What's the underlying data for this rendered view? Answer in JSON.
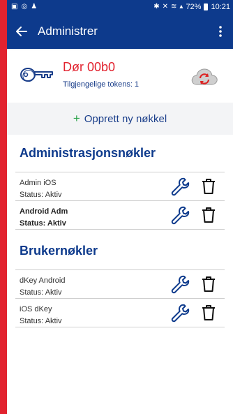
{
  "statusbar": {
    "left_icons": [
      "gallery-icon",
      "whatsapp-icon",
      "person-icon"
    ],
    "right_icons": [
      "bluetooth-icon",
      "mute-icon",
      "wifi-icon",
      "signal-icon"
    ],
    "battery": "72%",
    "time": "10:21"
  },
  "appbar": {
    "title": "Administrer",
    "back_icon": "arrow-left-icon",
    "menu_icon": "more-vertical-icon"
  },
  "door": {
    "name": "Dør 00b0",
    "tokens_label": "Tilgjengelige tokens: 1"
  },
  "create": {
    "plus": "+",
    "label": "Opprett ny nøkkel"
  },
  "admin_section": {
    "title": "Administrasjonsnøkler",
    "keys": [
      {
        "name": "Admin iOS",
        "status": "Status: Aktiv"
      },
      {
        "name": "Android Adm",
        "status": "Status: Aktiv"
      }
    ]
  },
  "user_section": {
    "title": "Brukernøkler",
    "keys": [
      {
        "name": "dKey Android",
        "status": "Status: Aktiv"
      },
      {
        "name": "iOS dKey",
        "status": "Status: Aktiv"
      }
    ]
  },
  "colors": {
    "primary": "#0d3a8c",
    "accent_red": "#e2232f",
    "plus_green": "#2aa34a"
  }
}
